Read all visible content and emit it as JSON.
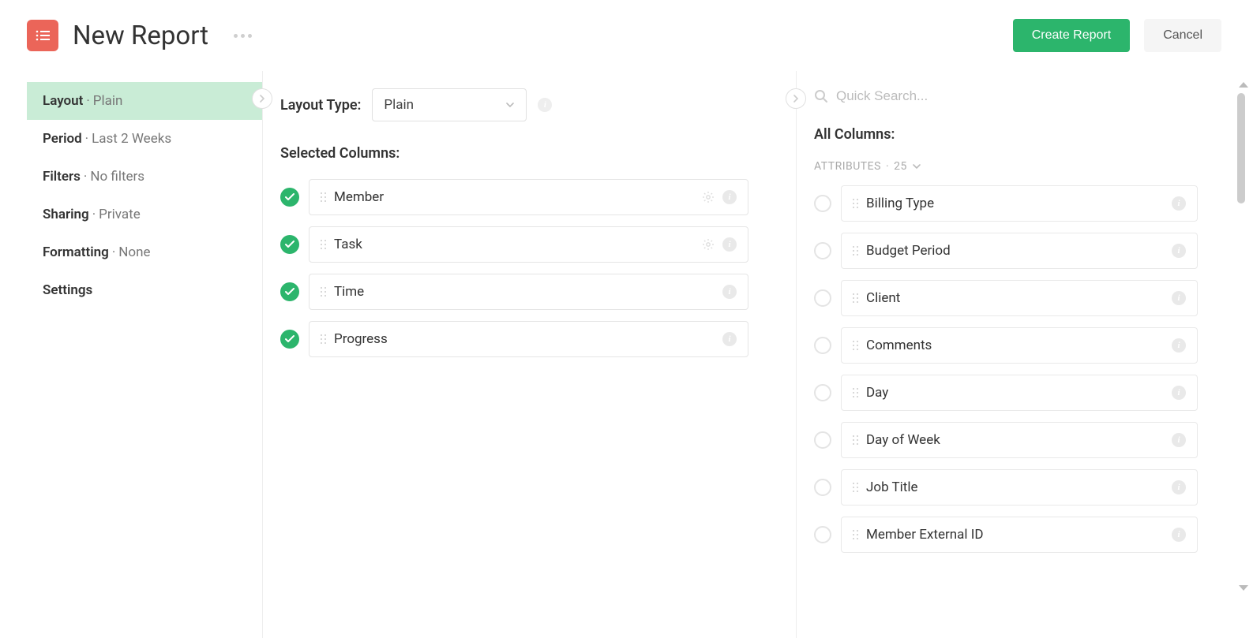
{
  "header": {
    "title": "New Report",
    "create_btn": "Create Report",
    "cancel_btn": "Cancel"
  },
  "sidebar": {
    "items": [
      {
        "label": "Layout",
        "value": "Plain",
        "active": true
      },
      {
        "label": "Period",
        "value": "Last 2 Weeks",
        "active": false
      },
      {
        "label": "Filters",
        "value": "No filters",
        "active": false
      },
      {
        "label": "Sharing",
        "value": "Private",
        "active": false
      },
      {
        "label": "Formatting",
        "value": "None",
        "active": false
      },
      {
        "label": "Settings",
        "value": "",
        "active": false
      }
    ]
  },
  "layout_panel": {
    "type_label": "Layout Type:",
    "type_value": "Plain",
    "selected_title": "Selected Columns:",
    "selected": [
      {
        "name": "Member",
        "has_gear": true
      },
      {
        "name": "Task",
        "has_gear": true
      },
      {
        "name": "Time",
        "has_gear": false
      },
      {
        "name": "Progress",
        "has_gear": false
      }
    ]
  },
  "all_panel": {
    "search_placeholder": "Quick Search...",
    "title": "All Columns:",
    "group_label": "ATTRIBUTES",
    "group_count": "25",
    "items": [
      "Billing Type",
      "Budget Period",
      "Client",
      "Comments",
      "Day",
      "Day of Week",
      "Job Title",
      "Member External ID"
    ]
  }
}
